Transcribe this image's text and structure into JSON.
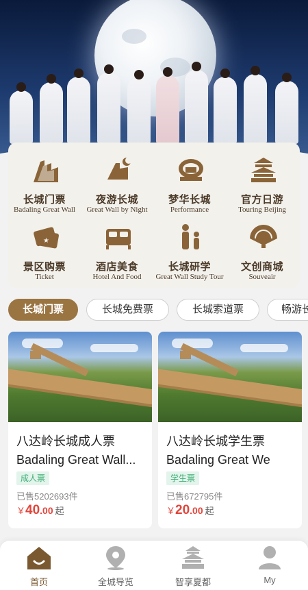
{
  "menu": {
    "items": [
      {
        "title": "长城门票",
        "subtitle": "Badaling Great Wall",
        "icon": "great-wall-icon"
      },
      {
        "title": "夜游长城",
        "subtitle": "Great Wall by Night",
        "icon": "night-wall-icon"
      },
      {
        "title": "梦华长城",
        "subtitle": "Performance",
        "icon": "stage-icon"
      },
      {
        "title": "官方日游",
        "subtitle": "Touring Beijing",
        "icon": "temple-icon"
      },
      {
        "title": "景区购票",
        "subtitle": "Ticket",
        "icon": "ticket-icon"
      },
      {
        "title": "酒店美食",
        "subtitle": "Hotel And Food",
        "icon": "bed-icon"
      },
      {
        "title": "长城研学",
        "subtitle": "Great Wall Study Tour",
        "icon": "family-icon"
      },
      {
        "title": "文创商城",
        "subtitle": "Souveair",
        "icon": "fan-icon"
      }
    ]
  },
  "tabs": [
    {
      "label": "长城门票",
      "active": true
    },
    {
      "label": "长城免费票",
      "active": false
    },
    {
      "label": "长城索道票",
      "active": false
    },
    {
      "label": "畅游长",
      "active": false
    }
  ],
  "products": [
    {
      "title": "八达岭长城成人票",
      "subtitle": "Badaling Great Wall...",
      "tag": "成人票",
      "sold": "已售5202693件",
      "currency": "￥",
      "price_int": "40",
      "price_dec": ".00",
      "price_suffix": "起"
    },
    {
      "title": "八达岭长城学生票",
      "subtitle": "Badaling Great We",
      "tag": "学生票",
      "sold": "已售672795件",
      "currency": "￥",
      "price_int": "20",
      "price_dec": ".00",
      "price_suffix": "起"
    }
  ],
  "nav": [
    {
      "label": "首页",
      "icon": "home-icon",
      "active": true
    },
    {
      "label": "全城导览",
      "icon": "location-pin-icon",
      "active": false
    },
    {
      "label": "智享夏都",
      "icon": "temple-icon",
      "active": false
    },
    {
      "label": "My",
      "icon": "user-icon",
      "active": false
    }
  ],
  "colors": {
    "brand_brown": "#9a7542",
    "icon_brown": "#7a5930",
    "price_red": "#e0463c",
    "tag_green": "#3fae74",
    "nav_gray": "#b0b0b0"
  }
}
